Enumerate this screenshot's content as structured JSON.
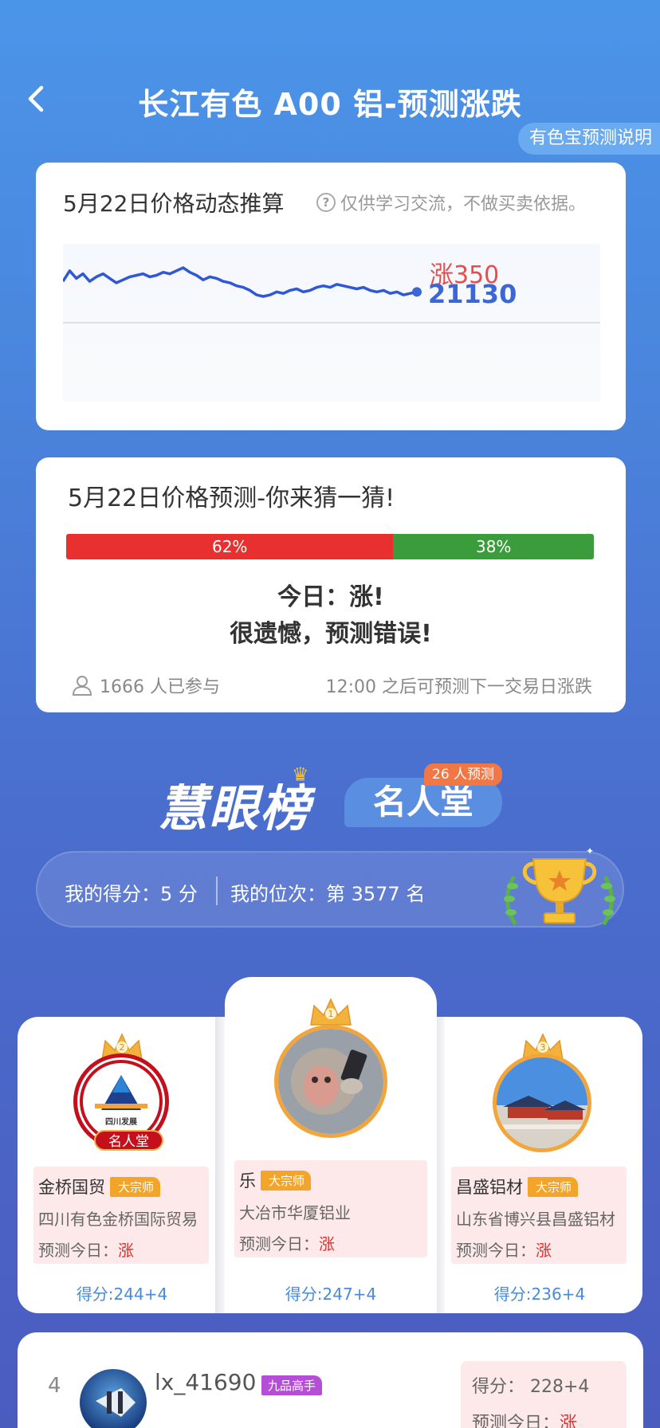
{
  "header": {
    "title": "长江有色 A00 铝-预测涨跌",
    "explain_label": "有色宝预测说明"
  },
  "price_card": {
    "title": "5月22日价格动态推算",
    "note": "仅供学习交流，不做买卖依据。",
    "change": "涨350",
    "price": "21130",
    "chart_data": {
      "type": "line",
      "series": [
        {
          "values": [
            21128,
            21135,
            21130,
            21133,
            21128,
            21131,
            21133,
            21130,
            21127,
            21129,
            21131,
            21132,
            21133,
            21131,
            21132,
            21134,
            21133,
            21135,
            21137,
            21134,
            21132,
            21129,
            21131,
            21130,
            21128,
            21127,
            21125,
            21124,
            21122,
            21119,
            21118,
            21119,
            21121,
            21120,
            21122,
            21123,
            21121,
            21122,
            21124,
            21125,
            21124,
            21126,
            21125,
            21124,
            21123,
            21124,
            21122,
            21121,
            21122,
            21120,
            21121,
            21119,
            21120,
            21121
          ]
        }
      ]
    }
  },
  "predict_card": {
    "title": "5月22日价格预测-你来猜一猜!",
    "up_pct_label": "62%",
    "down_pct_label": "38%",
    "up_fraction": 0.62,
    "today_label": "今日：涨!",
    "result_label": "很遗憾，预测错误!",
    "participants": "1666 人已参与",
    "next_note": "12:00 之后可预测下一交易日涨跌"
  },
  "leaderboard": {
    "title": "慧眼榜",
    "tab_label": "名人堂",
    "predict_count": "26 人预测",
    "my_score": "我的得分：5 分",
    "my_rank": "我的位次：第 3577 名",
    "podium": [
      {
        "rank": "2",
        "name": "金桥国贸",
        "tag": "大宗师",
        "company": "四川有色金桥国际贸易",
        "pred_label": "预测今日：",
        "pred_value": "涨",
        "score": "得分:244+4",
        "fame_badge": "名人堂",
        "logo_text": "四川发展"
      },
      {
        "rank": "1",
        "name": "乐",
        "tag": "大宗师",
        "company": "大冶市华厦铝业",
        "pred_label": "预测今日：",
        "pred_value": "涨",
        "score": "得分:247+4"
      },
      {
        "rank": "3",
        "name": "昌盛铝材",
        "tag": "大宗师",
        "company": "山东省博兴县昌盛铝材",
        "pred_label": "预测今日：",
        "pred_value": "涨",
        "score": "得分:236+4"
      }
    ],
    "row4": {
      "rank": "4",
      "name": "lx_41690",
      "tag": "九品高手",
      "score": "得分： 228+4",
      "pred_label": "预测今日：",
      "pred_value": "涨"
    }
  }
}
